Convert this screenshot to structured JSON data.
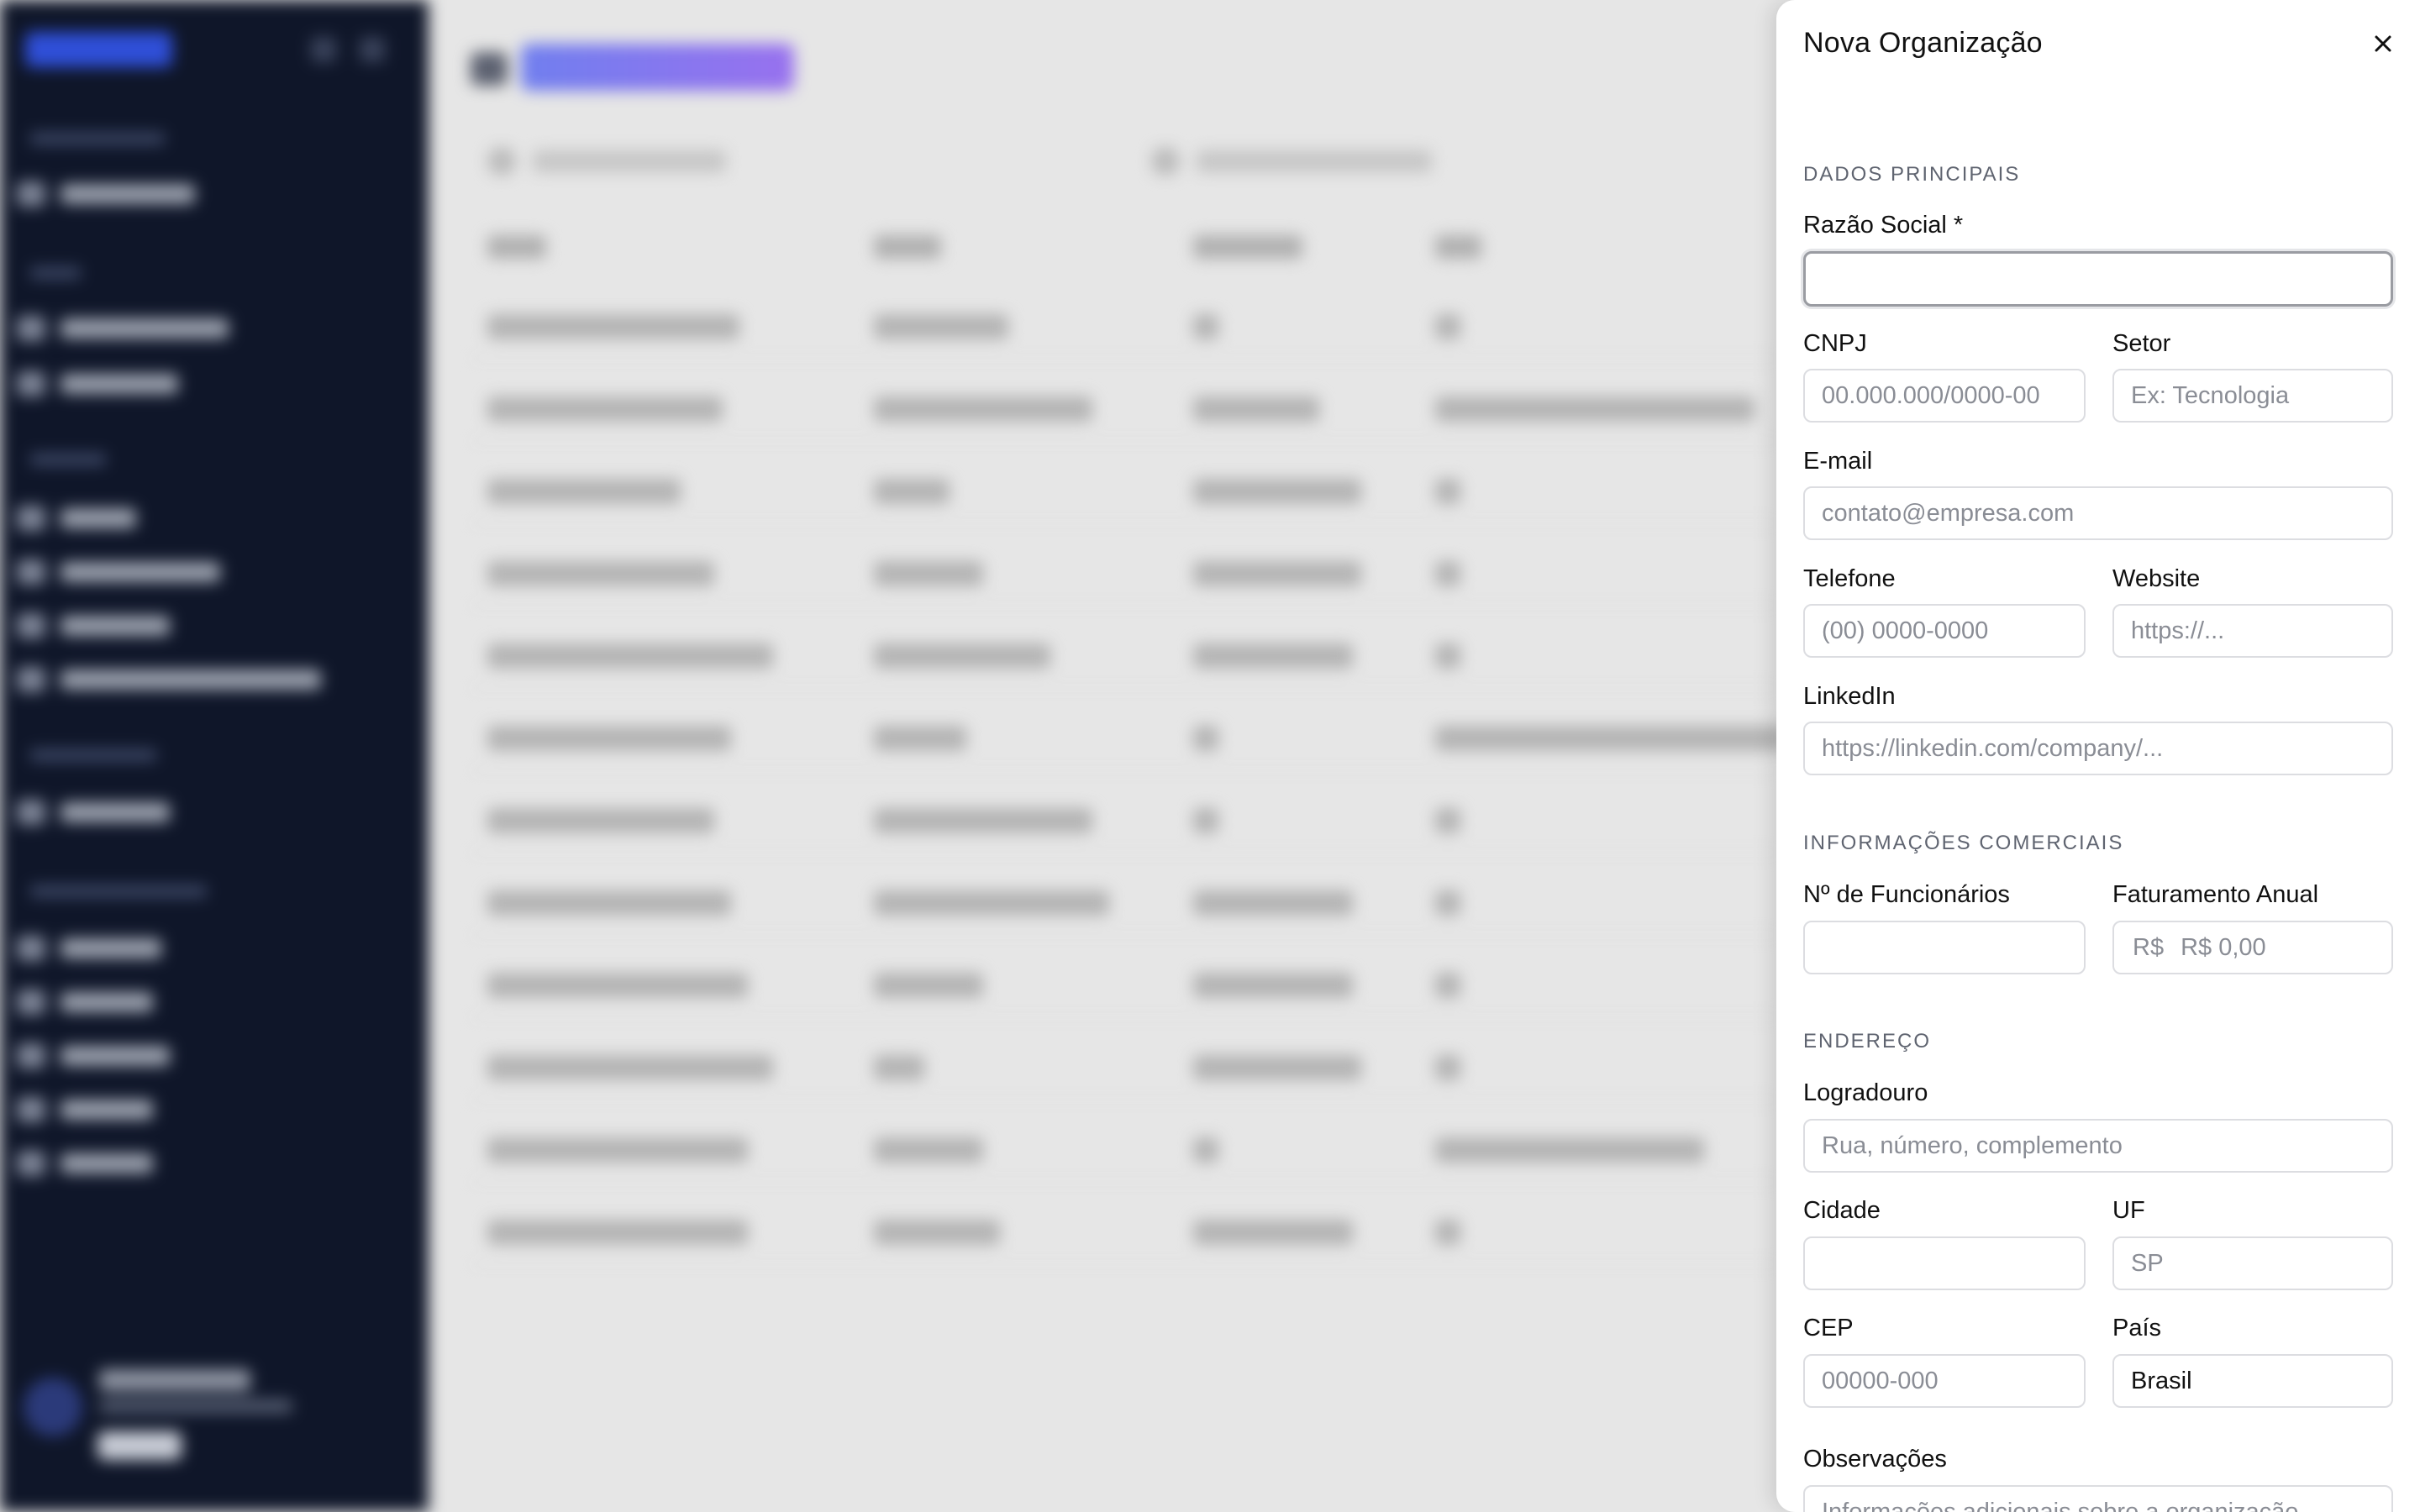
{
  "drawer": {
    "title": "Nova Organização",
    "close_label": "×",
    "sections": {
      "main": "DADOS PRINCIPAIS",
      "commercial": "INFORMAÇÕES COMERCIAIS",
      "address": "ENDEREÇO"
    },
    "fields": {
      "razao_social": {
        "label": "Razão Social *",
        "value": "",
        "placeholder": ""
      },
      "cnpj": {
        "label": "CNPJ",
        "placeholder": "00.000.000/0000-00"
      },
      "setor": {
        "label": "Setor",
        "placeholder": "Ex: Tecnologia"
      },
      "email": {
        "label": "E-mail",
        "placeholder": "contato@empresa.com"
      },
      "telefone": {
        "label": "Telefone",
        "placeholder": "(00) 0000-0000"
      },
      "website": {
        "label": "Website",
        "placeholder": "https://..."
      },
      "linkedin": {
        "label": "LinkedIn",
        "placeholder": "https://linkedin.com/company/..."
      },
      "funcionarios": {
        "label": "Nº de Funcionários",
        "placeholder": ""
      },
      "faturamento": {
        "label": "Faturamento Anual",
        "prefix": "R$",
        "placeholder": "R$ 0,00"
      },
      "logradouro": {
        "label": "Logradouro",
        "placeholder": "Rua, número, complemento"
      },
      "cidade": {
        "label": "Cidade",
        "placeholder": ""
      },
      "uf": {
        "label": "UF",
        "placeholder": "SP"
      },
      "cep": {
        "label": "CEP",
        "placeholder": "00000-000"
      },
      "pais": {
        "label": "País",
        "value": "Brasil"
      },
      "observacoes": {
        "label": "Observações",
        "placeholder": "Informações adicionais sobre a organização..."
      }
    }
  },
  "colors": {
    "sidebar_bg": "#0f1629",
    "overlay_bg": "#e6e6e6",
    "accent": "#5b6cf0"
  }
}
